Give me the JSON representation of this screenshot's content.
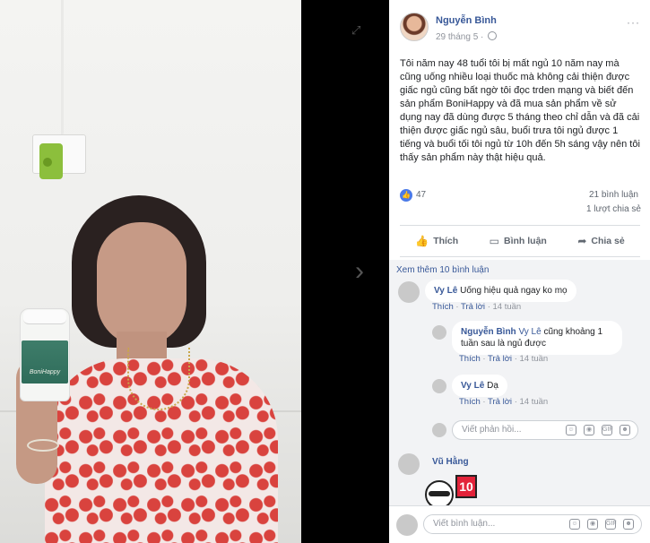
{
  "viewer": {
    "bottle_label": "BoniHappy"
  },
  "post": {
    "author": "Nguyễn Bình",
    "date": "29 tháng 5 ·",
    "more": "···",
    "text": "Tôi năm nay 48 tuổi tôi bị mất ngủ 10 năm nay mà cũng uống nhiều loại thuốc mà không cải thiện được giấc ngủ cũng bất ngờ tôi đọc trden mạng và biết đến sản phẩm BoniHappy và đã mua sản phẩm về sử dụng nay đã dùng được 5 tháng theo chỉ dẫn và đã cải thiện được giấc ngủ sâu, buổi trưa tôi ngủ được 1 tiếng và buổi tối tôi ngủ từ 10h đến 5h sáng vậy nên tôi thấy sản phẩm này thật hiệu quả.",
    "likes": "47",
    "comments_count": "21 bình luận",
    "shares_count": "1 lượt chia sẻ"
  },
  "actions": {
    "like": "Thích",
    "comment": "Bình luận",
    "share": "Chia sẻ"
  },
  "comments": {
    "view_more": "Xem thêm 10 bình luận",
    "items": [
      {
        "author": "Vy Lê",
        "text": "Uống hiệu quả ngay ko mọ",
        "like": "Thích",
        "reply": "Trả lời",
        "sep": "·",
        "time": "14 tuần"
      },
      {
        "author": "Nguyễn Bình",
        "mention": "Vy Lê",
        "text": "cũng khoảng 1 tuần sau là ngủ được",
        "like": "Thích",
        "reply": "Trả lời",
        "sep": "·",
        "time": "14 tuần"
      },
      {
        "author": "Vy Lê",
        "text": "Dạ",
        "like": "Thích",
        "reply": "Trả lời",
        "sep": "·",
        "time": "14 tuần"
      }
    ],
    "reply_placeholder": "Viết phản hồi...",
    "last_author": "Vũ Hằng",
    "sticker_number": "10"
  },
  "composer": {
    "placeholder": "Viết bình luận..."
  },
  "input_icons": {
    "emoji": "☺",
    "camera": "◉",
    "gif": "GIF",
    "sticker": "☻"
  },
  "colors": {
    "link": "#385898",
    "like_badge": "#4a7ae8"
  }
}
